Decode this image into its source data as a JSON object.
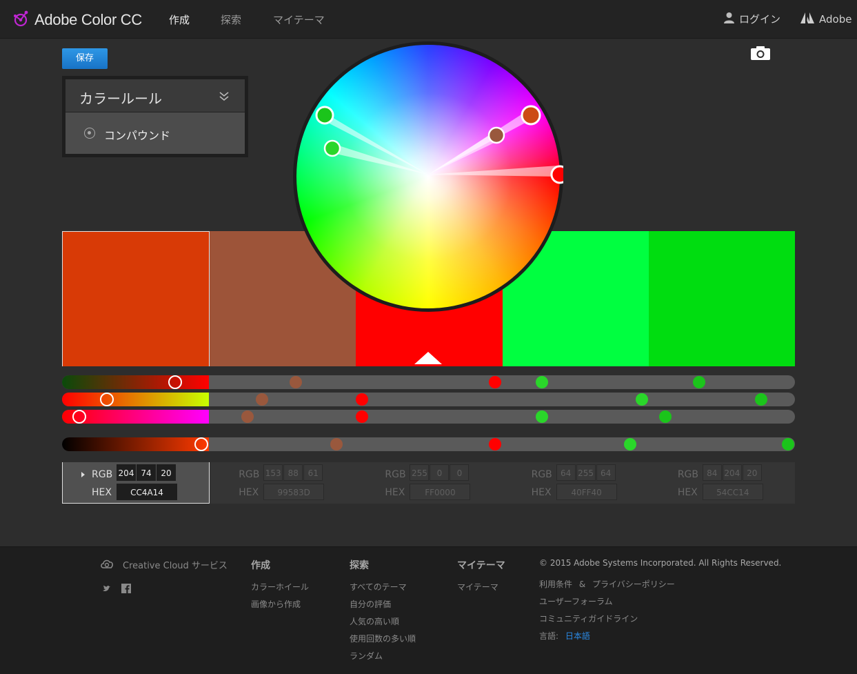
{
  "header": {
    "app_title": "Adobe Color CC",
    "nav": [
      {
        "label": "作成",
        "active": true
      },
      {
        "label": "探索",
        "active": false
      },
      {
        "label": "マイテーマ",
        "active": false
      }
    ],
    "login_label": "ログイン",
    "adobe_label": "Adobe"
  },
  "toolbar": {
    "save_label": "保存"
  },
  "rule_panel": {
    "title": "カラールール",
    "selected_rule": "コンパウンド"
  },
  "palette": {
    "selected_index": 0,
    "swatches": [
      {
        "hex": "CC4A14",
        "rgb": [
          "204",
          "74",
          "20"
        ],
        "color": "#CC4A14"
      },
      {
        "hex": "99583D",
        "rgb": [
          "153",
          "88",
          "61"
        ],
        "color": "#99583D"
      },
      {
        "hex": "FF0000",
        "rgb": [
          "255",
          "0",
          "0"
        ],
        "color": "#FF0000"
      },
      {
        "hex": "40FF40",
        "rgb": [
          "64",
          "255",
          "64"
        ],
        "color": "#40FF40"
      },
      {
        "hex": "54CC14",
        "rgb": [
          "84",
          "204",
          "20"
        ],
        "color": "#54CC14"
      }
    ],
    "rgb_label": "RGB",
    "hex_label": "HEX"
  },
  "footer": {
    "cc_services": "Creative Cloud サービス",
    "col_create": {
      "heading": "作成",
      "links": [
        "カラーホイール",
        "画像から作成"
      ]
    },
    "col_explore": {
      "heading": "探索",
      "links": [
        "すべてのテーマ",
        "自分の評価",
        "人気の高い順",
        "使用回数の多い順",
        "ランダム"
      ]
    },
    "col_mytheme": {
      "heading": "マイテーマ",
      "links": [
        "マイテーマ"
      ]
    },
    "copyright": "© 2015 Adobe Systems Incorporated. All Rights Reserved.",
    "terms": "利用条件",
    "amp": "&",
    "privacy": "プライバシーポリシー",
    "forum": "ユーザーフォーラム",
    "guidelines": "コミュニティガイドライン",
    "language_label": "言語:",
    "language_value": "日本語"
  }
}
